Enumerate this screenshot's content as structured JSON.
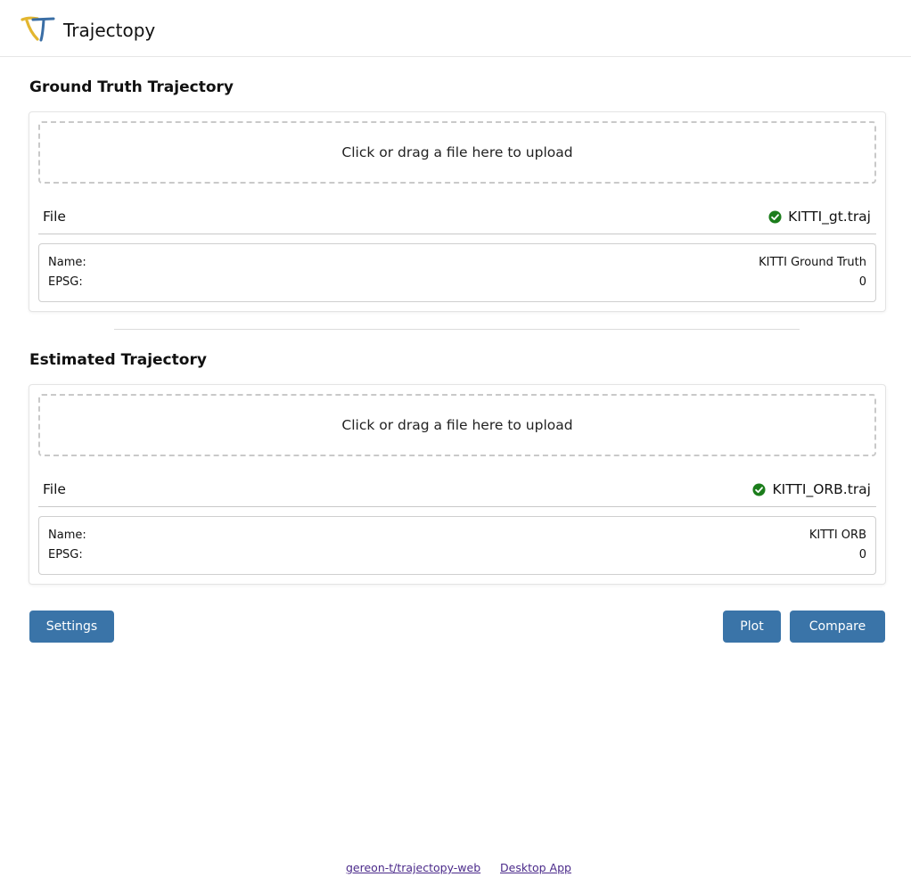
{
  "app": {
    "title": "Trajectopy",
    "logo_icon": "trajectopy-logo-icon"
  },
  "ground_truth": {
    "section_title": "Ground Truth Trajectory",
    "upload_text": "Click or drag a file here to upload",
    "file_label": "File",
    "file_name": "KITTI_gt.traj",
    "status_icon": "check-circle-icon",
    "status_color": "#1b7d1b",
    "meta": {
      "name_key": "Name:",
      "name_value": "KITTI Ground Truth",
      "epsg_key": "EPSG:",
      "epsg_value": "0"
    }
  },
  "estimated": {
    "section_title": "Estimated Trajectory",
    "upload_text": "Click or drag a file here to upload",
    "file_label": "File",
    "file_name": "KITTI_ORB.traj",
    "status_icon": "check-circle-icon",
    "status_color": "#1b7d1b",
    "meta": {
      "name_key": "Name:",
      "name_value": "KITTI ORB",
      "epsg_key": "EPSG:",
      "epsg_value": "0"
    }
  },
  "actions": {
    "settings_label": "Settings",
    "plot_label": "Plot",
    "compare_label": "Compare",
    "button_color": "#3a74a8"
  },
  "footer": {
    "repo_link": "gereon-t/trajectopy-web",
    "desktop_link": "Desktop App",
    "link_color": "#4b2a8a"
  }
}
